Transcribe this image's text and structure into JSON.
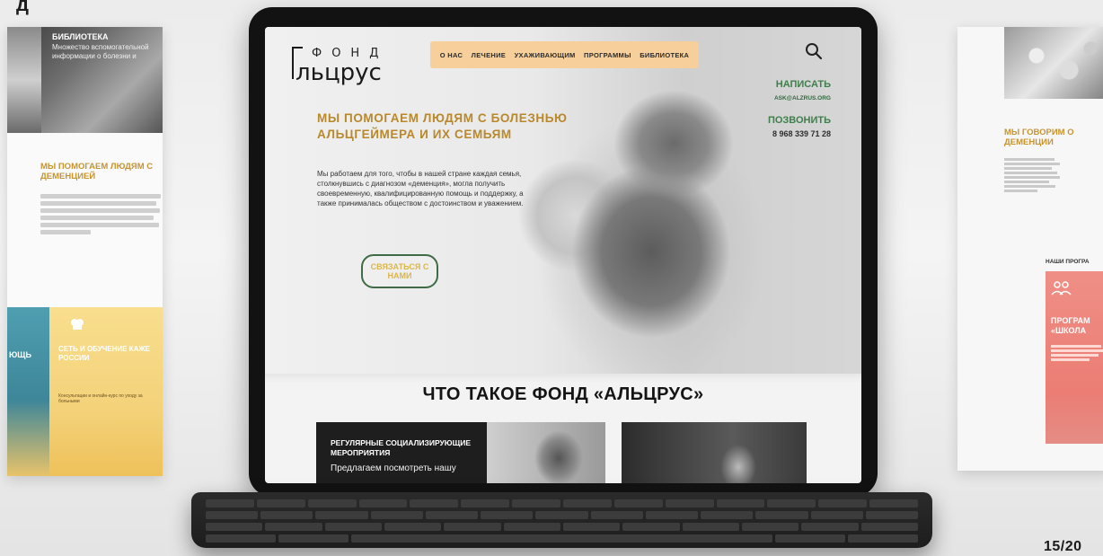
{
  "top_partial_title": "д",
  "left_panel": {
    "library_title": "БИБЛИОТЕКА",
    "library_text": "Множество вспомогательной информации о болезни и",
    "heading": "МЫ ПОМОГАЕМ ЛЮДЯМ С ДЕМЕНЦИЕЙ",
    "blue_card_text": "ЮЩЬ",
    "yellow_card_title": "СЕТЬ И ОБУЧЕНИЕ КАЖЕ РОССИИ",
    "yellow_card_sub": "Консультации и онлайн-курс по уходу за больными"
  },
  "tablet": {
    "logo": {
      "fond": "ФОНД",
      "name": "льцрус"
    },
    "nav": [
      "О НАС",
      "ЛЕЧЕНИЕ",
      "УХАЖИВАЮЩИМ",
      "ПРОГРАММЫ",
      "БИБЛИОТЕКА"
    ],
    "contacts": {
      "write_label": "НАПИСАТЬ",
      "email": "ASK@ALZRUS.ORG",
      "call_label": "ПОЗВОНИТЬ",
      "phone": "8 968 339 71 28"
    },
    "hero": {
      "title": "МЫ ПОМОГАЕМ ЛЮДЯМ С БОЛЕЗНЬЮ АЛЬЦГЕЙМЕРА И ИХ СЕМЬЯМ",
      "text": "Мы работаем для того, чтобы в нашей стране каждая семья, столкнувшись с диагнозом «деменция», могла получить своевременную, квалифицированную помощь и поддержку, а также принималась обществом с достоинством и уважением.",
      "cta": "СВЯЗАТЬСЯ С НАМИ"
    },
    "section_title": "ЧТО ТАКОЕ ФОНД «АЛЬЦРУС»",
    "card1": {
      "title": "РЕГУЛЯРНЫЕ СОЦИАЛИЗИРУЮЩИЕ МЕРОПРИЯТИЯ",
      "sub": "Предлагаем посмотреть нашу"
    }
  },
  "right_panel": {
    "heading": "МЫ ГОВОРИМ О ДЕМЕНЦИИ",
    "programs_label": "НАШИ ПРОГРА",
    "pink_card_title": "ПРОГРАМ «ШКОЛА"
  },
  "page_counter": "15/20",
  "colors": {
    "gold": "#b9882b",
    "green": "#3e7f4a",
    "nav_bg": "#f6cf9a"
  }
}
